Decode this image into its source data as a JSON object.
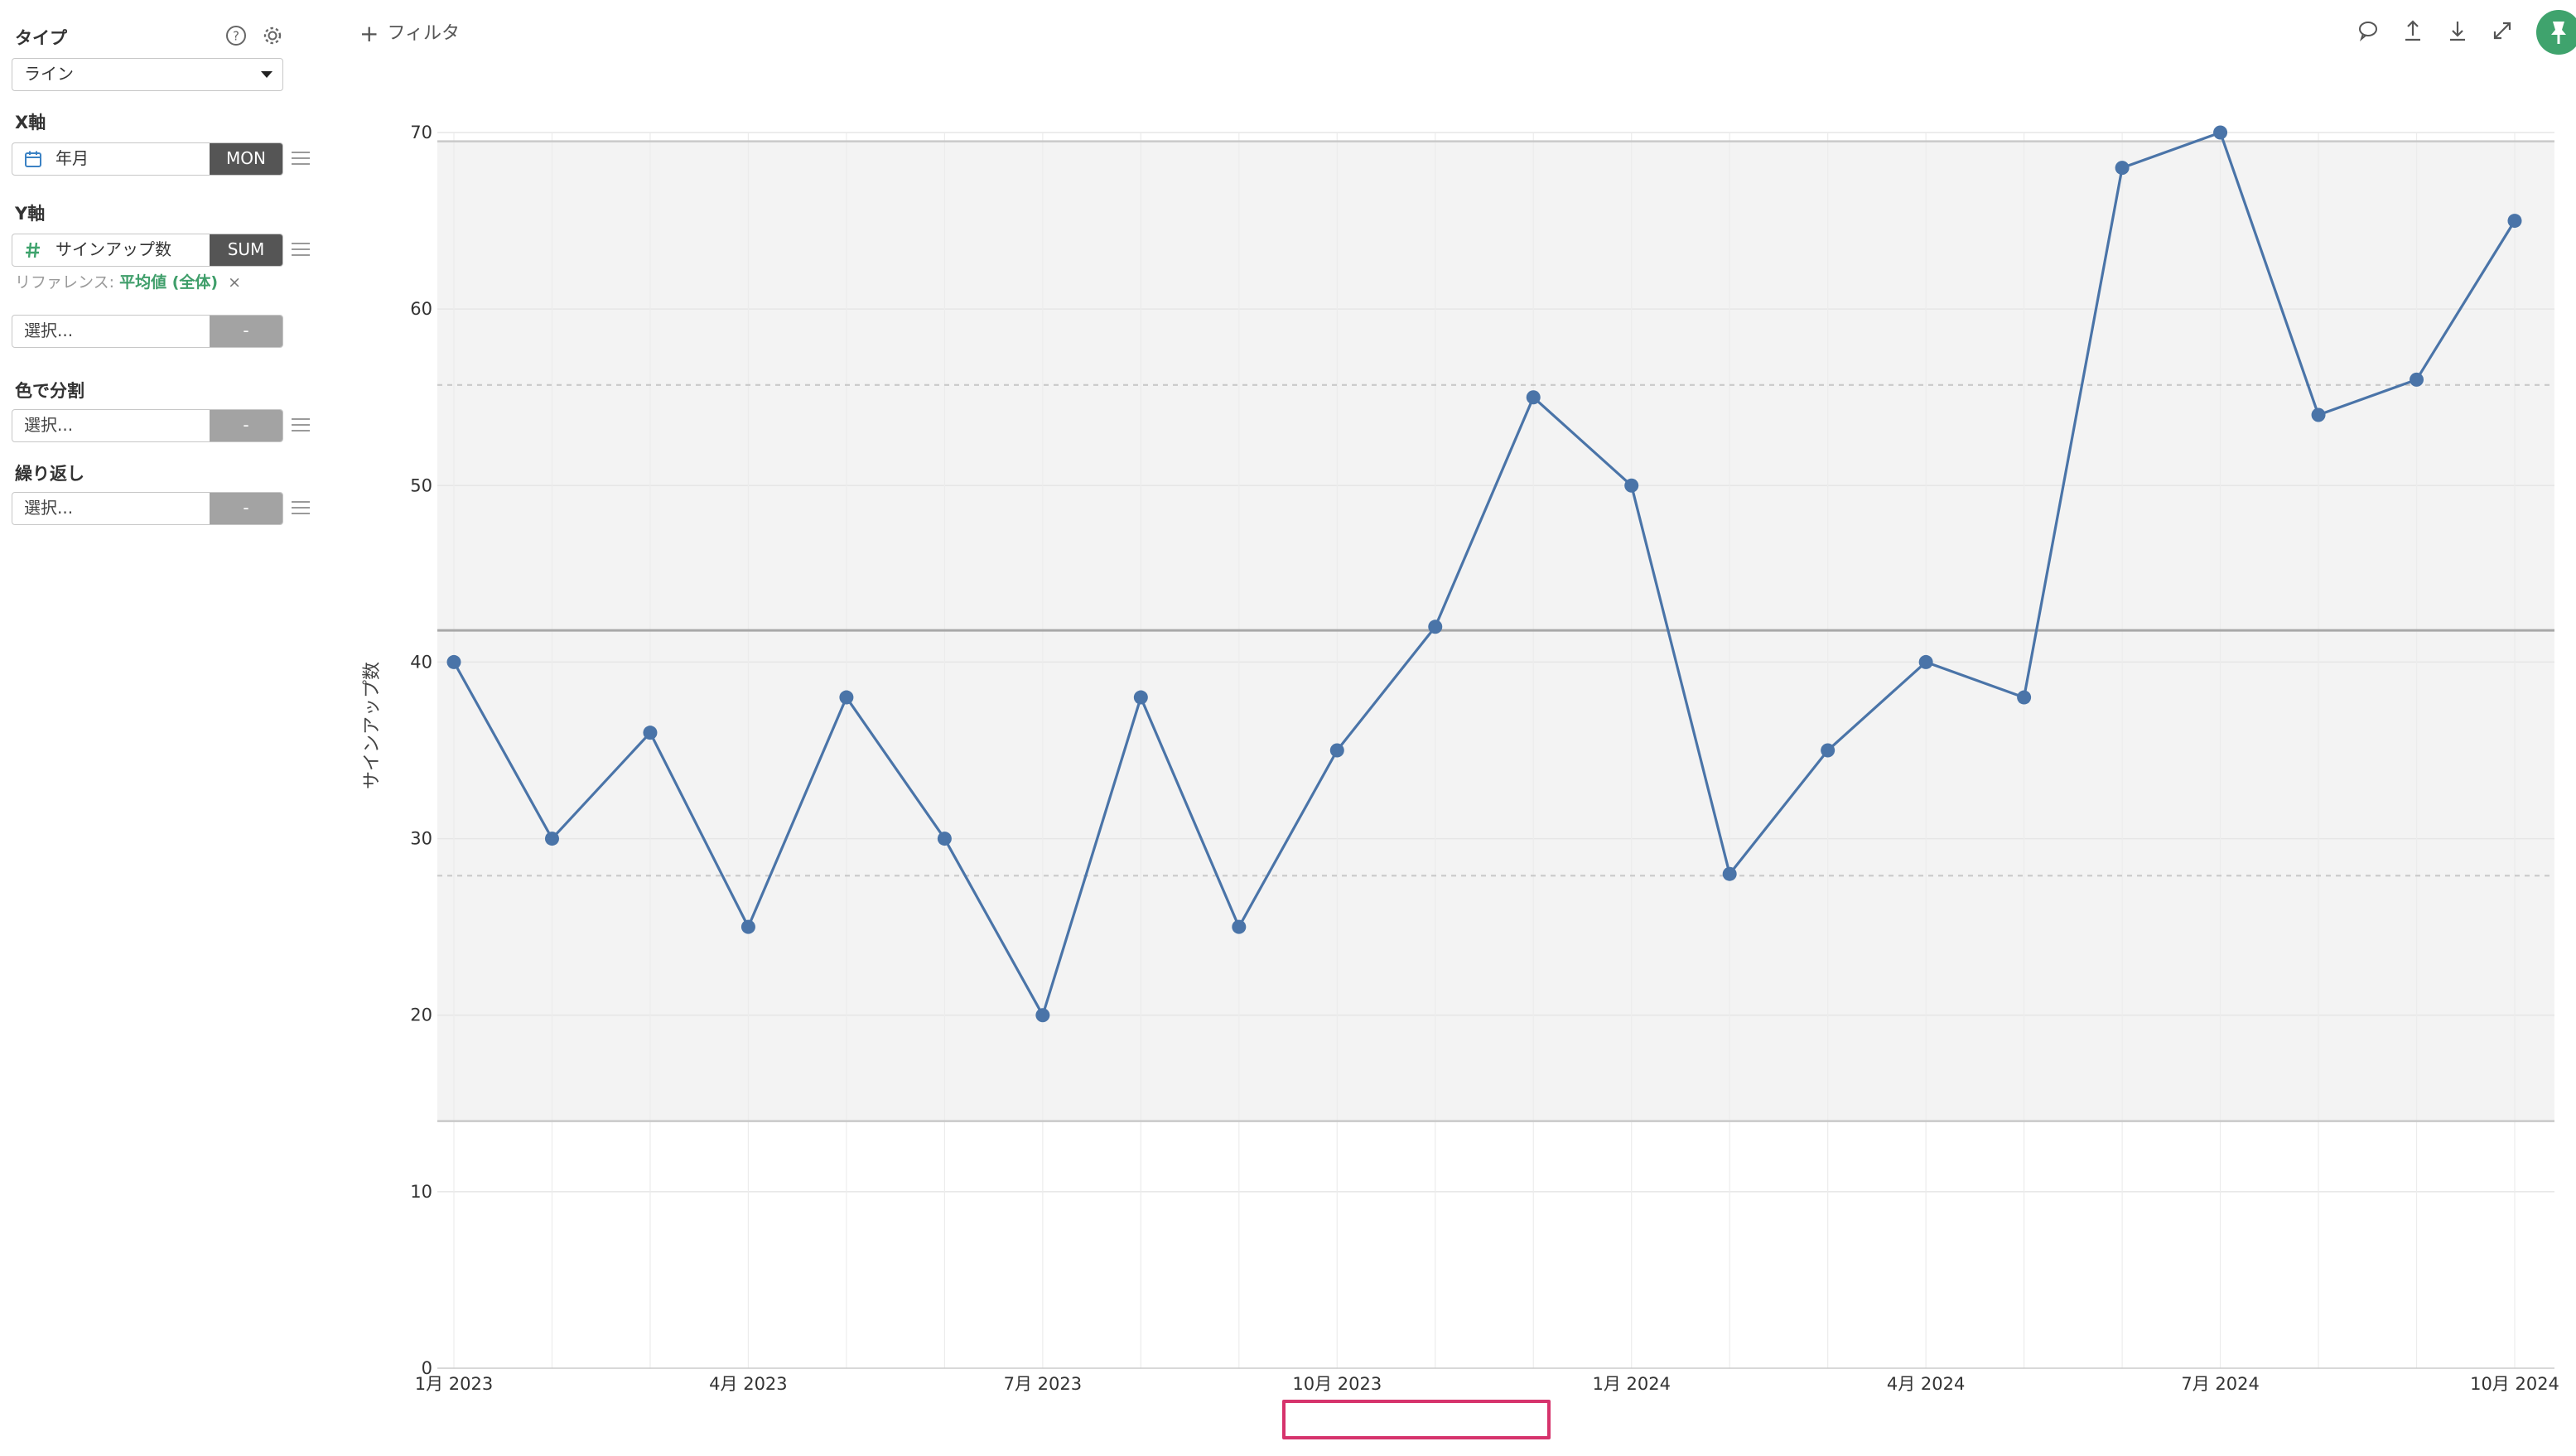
{
  "sidebar": {
    "type_label": "タイプ",
    "type_value": "ライン",
    "x_axis_label": "X軸",
    "x_field": "年月",
    "x_agg": "MON",
    "y_axis_label": "Y軸",
    "y_field": "サインアップ数",
    "y_agg": "SUM",
    "reference_prefix": "リファレンス:",
    "reference_value": "平均値 (全体)",
    "reference_remove": "×",
    "select_placeholder": "選択...",
    "dash": "-",
    "color_split_label": "色で分割",
    "repeat_label": "繰り返し"
  },
  "toolbar": {
    "filter_plus": "+",
    "filter_label": "フィルタ"
  },
  "colors": {
    "line": "#4a74a8",
    "band": "#f3f3f3",
    "accent": "#3fa36d",
    "highlight": "#d6336c"
  },
  "chart_data": {
    "type": "line",
    "ylabel": "サインアップ数",
    "xlabel": "",
    "ylim": [
      0,
      70
    ],
    "yticks": [
      0,
      10,
      20,
      30,
      40,
      50,
      60,
      70
    ],
    "x": [
      "2023-01",
      "2023-02",
      "2023-03",
      "2023-04",
      "2023-05",
      "2023-06",
      "2023-07",
      "2023-08",
      "2023-09",
      "2023-10",
      "2023-11",
      "2023-12",
      "2024-01",
      "2024-02",
      "2024-03",
      "2024-04",
      "2024-05",
      "2024-06",
      "2024-07",
      "2024-08",
      "2024-09",
      "2024-10"
    ],
    "xtick_labels": [
      "1月 2023",
      "4月 2023",
      "7月 2023",
      "10月 2023",
      "1月 2024",
      "4月 2024",
      "7月 2024",
      "10月 2024"
    ],
    "xtick_months": [
      "2023-01",
      "2023-04",
      "2023-07",
      "2023-10",
      "2024-01",
      "2024-04",
      "2024-07",
      "2024-10"
    ],
    "series": [
      {
        "values": [
          40,
          30,
          36,
          25,
          38,
          30,
          20,
          38,
          25,
          35,
          42,
          55,
          50,
          28,
          35,
          40,
          38,
          68,
          70,
          54,
          56,
          65
        ]
      }
    ],
    "reference": {
      "mean": 41.8,
      "inner_band": [
        27.9,
        55.7
      ],
      "outer_band": [
        14.0,
        69.5
      ]
    },
    "grid": true,
    "legend": "none"
  }
}
